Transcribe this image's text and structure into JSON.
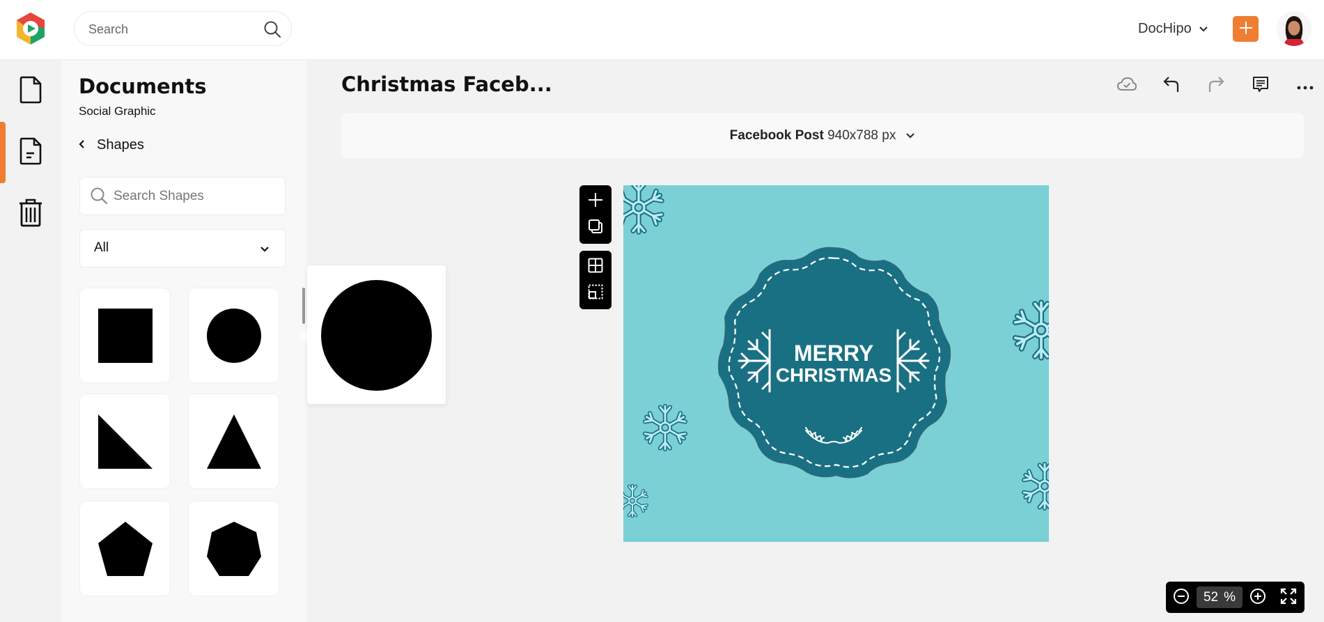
{
  "header": {
    "search_placeholder": "Search",
    "workspace_label": "DocHipo",
    "add_button_label": "+",
    "brand_colors": {
      "accent": "#ef7e32",
      "logo_red": "#e8453c",
      "logo_yellow": "#f4b52e",
      "logo_green": "#1fa463"
    }
  },
  "rail": {
    "items": [
      {
        "name": "new-document",
        "active": false
      },
      {
        "name": "documents",
        "active": true
      },
      {
        "name": "trash",
        "active": false
      }
    ]
  },
  "panel": {
    "title": "Documents",
    "subtitle": "Social Graphic",
    "section_label": "Shapes",
    "search_placeholder": "Search Shapes",
    "category_selected": "All",
    "shapes": [
      {
        "name": "square"
      },
      {
        "name": "circle"
      },
      {
        "name": "right-triangle"
      },
      {
        "name": "triangle"
      },
      {
        "name": "pentagon"
      },
      {
        "name": "heptagon"
      }
    ],
    "preview_shape": "circle"
  },
  "editor": {
    "document_title": "Christmas Faceb...",
    "size_type": "Facebook Post",
    "size_dims": "940x788 px",
    "toolbar": [
      "cloud-saved",
      "undo",
      "redo",
      "comments",
      "more"
    ],
    "side_tools": [
      "add",
      "duplicate",
      "grid",
      "select-area"
    ],
    "canvas": {
      "background": "#7bd0d5",
      "badge_color": "#1a7083",
      "line1": "MERRY",
      "line2": "CHRISTMAS"
    },
    "zoom_value": "52",
    "zoom_unit": "%"
  }
}
